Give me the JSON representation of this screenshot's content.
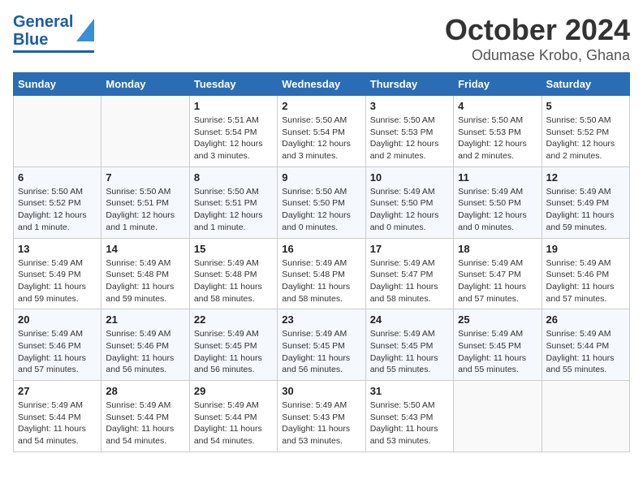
{
  "header": {
    "logo_line1": "General",
    "logo_line2": "Blue",
    "month": "October 2024",
    "location": "Odumase Krobo, Ghana"
  },
  "days_of_week": [
    "Sunday",
    "Monday",
    "Tuesday",
    "Wednesday",
    "Thursday",
    "Friday",
    "Saturday"
  ],
  "weeks": [
    [
      {
        "day": "",
        "info": ""
      },
      {
        "day": "",
        "info": ""
      },
      {
        "day": "1",
        "info": "Sunrise: 5:51 AM\nSunset: 5:54 PM\nDaylight: 12 hours and 3 minutes."
      },
      {
        "day": "2",
        "info": "Sunrise: 5:50 AM\nSunset: 5:54 PM\nDaylight: 12 hours and 3 minutes."
      },
      {
        "day": "3",
        "info": "Sunrise: 5:50 AM\nSunset: 5:53 PM\nDaylight: 12 hours and 2 minutes."
      },
      {
        "day": "4",
        "info": "Sunrise: 5:50 AM\nSunset: 5:53 PM\nDaylight: 12 hours and 2 minutes."
      },
      {
        "day": "5",
        "info": "Sunrise: 5:50 AM\nSunset: 5:52 PM\nDaylight: 12 hours and 2 minutes."
      }
    ],
    [
      {
        "day": "6",
        "info": "Sunrise: 5:50 AM\nSunset: 5:52 PM\nDaylight: 12 hours and 1 minute."
      },
      {
        "day": "7",
        "info": "Sunrise: 5:50 AM\nSunset: 5:51 PM\nDaylight: 12 hours and 1 minute."
      },
      {
        "day": "8",
        "info": "Sunrise: 5:50 AM\nSunset: 5:51 PM\nDaylight: 12 hours and 1 minute."
      },
      {
        "day": "9",
        "info": "Sunrise: 5:50 AM\nSunset: 5:50 PM\nDaylight: 12 hours and 0 minutes."
      },
      {
        "day": "10",
        "info": "Sunrise: 5:49 AM\nSunset: 5:50 PM\nDaylight: 12 hours and 0 minutes."
      },
      {
        "day": "11",
        "info": "Sunrise: 5:49 AM\nSunset: 5:50 PM\nDaylight: 12 hours and 0 minutes."
      },
      {
        "day": "12",
        "info": "Sunrise: 5:49 AM\nSunset: 5:49 PM\nDaylight: 11 hours and 59 minutes."
      }
    ],
    [
      {
        "day": "13",
        "info": "Sunrise: 5:49 AM\nSunset: 5:49 PM\nDaylight: 11 hours and 59 minutes."
      },
      {
        "day": "14",
        "info": "Sunrise: 5:49 AM\nSunset: 5:48 PM\nDaylight: 11 hours and 59 minutes."
      },
      {
        "day": "15",
        "info": "Sunrise: 5:49 AM\nSunset: 5:48 PM\nDaylight: 11 hours and 58 minutes."
      },
      {
        "day": "16",
        "info": "Sunrise: 5:49 AM\nSunset: 5:48 PM\nDaylight: 11 hours and 58 minutes."
      },
      {
        "day": "17",
        "info": "Sunrise: 5:49 AM\nSunset: 5:47 PM\nDaylight: 11 hours and 58 minutes."
      },
      {
        "day": "18",
        "info": "Sunrise: 5:49 AM\nSunset: 5:47 PM\nDaylight: 11 hours and 57 minutes."
      },
      {
        "day": "19",
        "info": "Sunrise: 5:49 AM\nSunset: 5:46 PM\nDaylight: 11 hours and 57 minutes."
      }
    ],
    [
      {
        "day": "20",
        "info": "Sunrise: 5:49 AM\nSunset: 5:46 PM\nDaylight: 11 hours and 57 minutes."
      },
      {
        "day": "21",
        "info": "Sunrise: 5:49 AM\nSunset: 5:46 PM\nDaylight: 11 hours and 56 minutes."
      },
      {
        "day": "22",
        "info": "Sunrise: 5:49 AM\nSunset: 5:45 PM\nDaylight: 11 hours and 56 minutes."
      },
      {
        "day": "23",
        "info": "Sunrise: 5:49 AM\nSunset: 5:45 PM\nDaylight: 11 hours and 56 minutes."
      },
      {
        "day": "24",
        "info": "Sunrise: 5:49 AM\nSunset: 5:45 PM\nDaylight: 11 hours and 55 minutes."
      },
      {
        "day": "25",
        "info": "Sunrise: 5:49 AM\nSunset: 5:45 PM\nDaylight: 11 hours and 55 minutes."
      },
      {
        "day": "26",
        "info": "Sunrise: 5:49 AM\nSunset: 5:44 PM\nDaylight: 11 hours and 55 minutes."
      }
    ],
    [
      {
        "day": "27",
        "info": "Sunrise: 5:49 AM\nSunset: 5:44 PM\nDaylight: 11 hours and 54 minutes."
      },
      {
        "day": "28",
        "info": "Sunrise: 5:49 AM\nSunset: 5:44 PM\nDaylight: 11 hours and 54 minutes."
      },
      {
        "day": "29",
        "info": "Sunrise: 5:49 AM\nSunset: 5:44 PM\nDaylight: 11 hours and 54 minutes."
      },
      {
        "day": "30",
        "info": "Sunrise: 5:49 AM\nSunset: 5:43 PM\nDaylight: 11 hours and 53 minutes."
      },
      {
        "day": "31",
        "info": "Sunrise: 5:50 AM\nSunset: 5:43 PM\nDaylight: 11 hours and 53 minutes."
      },
      {
        "day": "",
        "info": ""
      },
      {
        "day": "",
        "info": ""
      }
    ]
  ]
}
